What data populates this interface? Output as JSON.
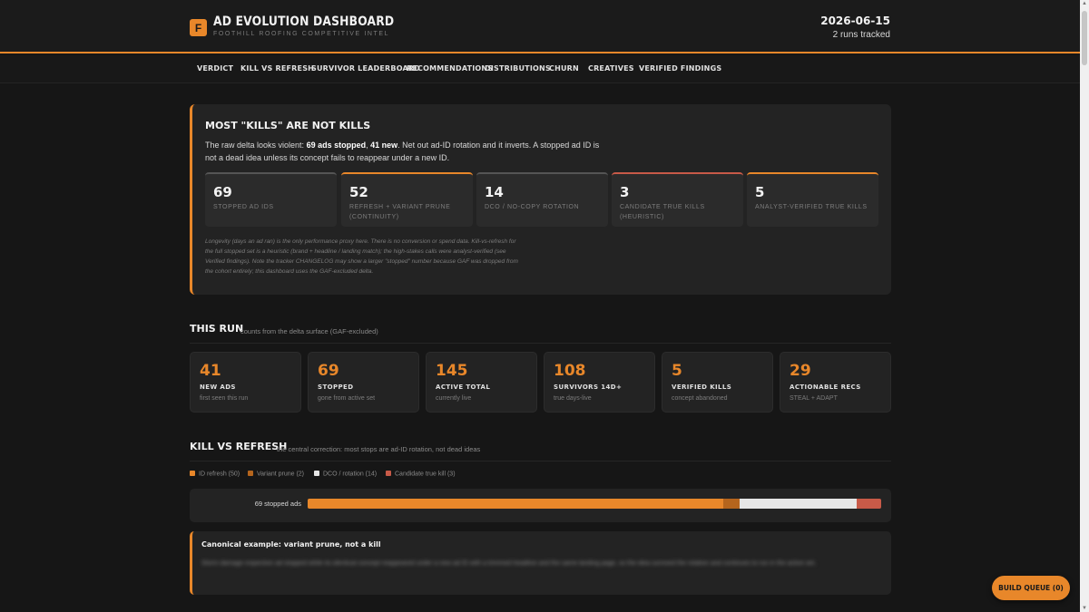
{
  "header": {
    "logo_letter": "F",
    "title": "AD EVOLUTION DASHBOARD",
    "subtitle": "FOOTHILL ROOFING COMPETITIVE INTEL",
    "date": "2026-06-15",
    "runs": "2 runs tracked"
  },
  "nav": [
    "VERDICT",
    "KILL VS REFRESH",
    "SURVIVOR LEADERBOARD",
    "RECOMMENDATIONS",
    "DISTRIBUTIONS",
    "CHURN",
    "CREATIVES",
    "VERIFIED FINDINGS"
  ],
  "verdict": {
    "title": "MOST \"KILLS\" ARE NOT KILLS",
    "body_pre": "The raw delta looks violent: ",
    "body_b1": "69 ads stopped",
    "body_mid": ", ",
    "body_b2": "41 new",
    "body_post": ". Net out ad-ID rotation and it inverts. A stopped ad ID is not a dead idea unless its concept fails to reappear under a new ID.",
    "stats": [
      {
        "value": "69",
        "label": "STOPPED AD IDS",
        "accent": "grey"
      },
      {
        "value": "52",
        "label": "REFRESH + VARIANT PRUNE (CONTINUITY)",
        "accent": "orange"
      },
      {
        "value": "14",
        "label": "DCO / NO-COPY ROTATION",
        "accent": "grey"
      },
      {
        "value": "3",
        "label": "CANDIDATE TRUE KILLS (HEURISTIC)",
        "accent": "red"
      },
      {
        "value": "5",
        "label": "ANALYST-VERIFIED TRUE KILLS",
        "accent": "orange"
      }
    ],
    "note": "Longevity (days an ad ran) is the only performance proxy here. There is no conversion or spend data. Kill-vs-refresh for the full stopped set is a heuristic (brand + headline / landing match); the high-stakes calls were analyst-verified (see Verified findings). Note the tracker CHANGELOG may show a larger \"stopped\" number because GAF was dropped from the cohort entirely; this dashboard uses the GAF-excluded delta."
  },
  "this_run": {
    "title": "THIS RUN",
    "note": "counts from the delta surface (GAF-excluded)",
    "cards": [
      {
        "value": "41",
        "label": "NEW ADS",
        "sub": "first seen this run"
      },
      {
        "value": "69",
        "label": "STOPPED",
        "sub": "gone from active set"
      },
      {
        "value": "145",
        "label": "ACTIVE TOTAL",
        "sub": "currently live"
      },
      {
        "value": "108",
        "label": "SURVIVORS 14D+",
        "sub": "true days-live"
      },
      {
        "value": "5",
        "label": "VERIFIED KILLS",
        "sub": "concept abandoned"
      },
      {
        "value": "29",
        "label": "ACTIONABLE RECS",
        "sub": "STEAL + ADAPT"
      }
    ]
  },
  "kill_vs_refresh": {
    "title": "KILL VS REFRESH",
    "note": "the central correction: most stops are ad-ID rotation, not dead ideas",
    "legend": [
      {
        "label": "ID refresh (50)",
        "color": "#e8872a"
      },
      {
        "label": "Variant prune (2)",
        "color": "#b5651d"
      },
      {
        "label": "DCO / rotation (14)",
        "color": "#e6e6e6"
      },
      {
        "label": "Candidate true kill (3)",
        "color": "#c85a48"
      }
    ],
    "bar_label": "69 stopped ads",
    "segments": [
      50,
      2,
      14,
      3
    ],
    "colors": [
      "#e8872a",
      "#b5651d",
      "#e6e6e6",
      "#c85a48"
    ]
  },
  "example": {
    "title": "Canonical example: variant prune, not a kill",
    "blurred_text": "Storm damage inspection ad stopped while its identical concept reappeared under a new ad ID with a trimmed headline and the same landing page, so the idea survived the rotation and continues to run in the active set."
  },
  "build_queue": "BUILD QUEUE (0)"
}
